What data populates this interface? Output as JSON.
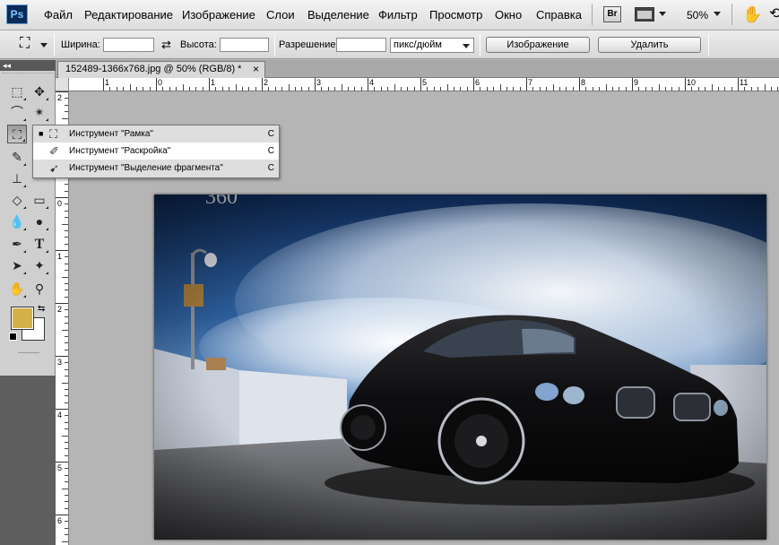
{
  "app": {
    "logo": "Ps"
  },
  "menu": [
    "Файл",
    "Редактирование",
    "Изображение",
    "Слои",
    "Выделение",
    "Фильтр",
    "Просмотр",
    "Окно",
    "Справка"
  ],
  "appbar": {
    "bridge_label": "Br",
    "zoom": "50%"
  },
  "options": {
    "width_label": "Ширина:",
    "width_value": "",
    "height_label": "Высота:",
    "height_value": "",
    "resolution_label": "Разрешение:",
    "resolution_value": "",
    "units": "пикс/дюйм",
    "image_button": "Изображение",
    "delete_button": "Удалить"
  },
  "toolbox": {
    "header": "◂◂",
    "foreground_color": "#d4b049",
    "background_color": "#ffffff"
  },
  "document": {
    "tab_title": "152489-1366x768.jpg @ 50% (RGB/8) *",
    "close": "×"
  },
  "ruler": {
    "h_labels": [
      "1",
      "0",
      "1",
      "2",
      "3",
      "4",
      "5",
      "6",
      "7",
      "8",
      "9",
      "10",
      "11"
    ],
    "v_labels": [
      "2",
      "1",
      "0",
      "1",
      "2",
      "3",
      "4",
      "5",
      "6"
    ]
  },
  "flyout": {
    "items": [
      {
        "label": "Инструмент \"Рамка\"",
        "shortcut": "C",
        "selected": true,
        "icon": "crop-icon"
      },
      {
        "label": "Инструмент \"Раскройка\"",
        "shortcut": "C",
        "selected": false,
        "icon": "slice-icon"
      },
      {
        "label": "Инструмент \"Выделение фрагмента\"",
        "shortcut": "C",
        "selected": false,
        "icon": "slice-select-icon"
      }
    ]
  },
  "photo": {
    "watermark": "360"
  }
}
